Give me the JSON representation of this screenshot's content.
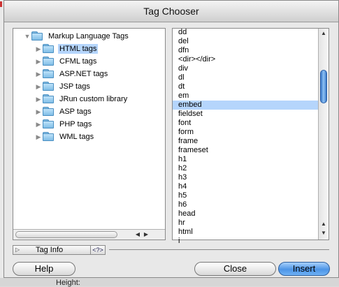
{
  "window": {
    "title": "Tag Chooser"
  },
  "tree": {
    "root": "Markup Language Tags",
    "children": [
      "HTML tags",
      "CFML tags",
      "ASP.NET tags",
      "JSP tags",
      "JRun custom library",
      "ASP tags",
      "PHP tags",
      "WML tags"
    ],
    "selected_index": 0
  },
  "tag_list": {
    "items": [
      "dd",
      "del",
      "dfn",
      "<dir></dir>",
      "div",
      "dl",
      "dt",
      "em",
      "embed",
      "fieldset",
      "font",
      "form",
      "frame",
      "frameset",
      "h1",
      "h2",
      "h3",
      "h4",
      "h5",
      "h6",
      "head",
      "hr",
      "html",
      "i"
    ],
    "selected": "embed"
  },
  "tag_info": {
    "label": "Tag Info"
  },
  "buttons": {
    "help": "Help",
    "close": "Close",
    "insert": "Insert"
  },
  "background": {
    "partial_text": "Height:"
  },
  "colors": {
    "selection": "#b5d5fc",
    "default_button": "#4d95e6"
  }
}
